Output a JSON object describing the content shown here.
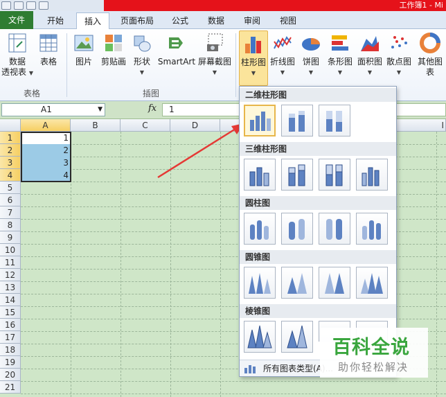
{
  "window": {
    "title": "工作簿1 - Mi"
  },
  "tabs": {
    "file": "文件",
    "home": "开始",
    "insert": "插入",
    "layout": "页面布局",
    "formulas": "公式",
    "data": "数据",
    "review": "审阅",
    "view": "视图"
  },
  "ribbon": {
    "pivot_line1": "数据",
    "pivot_line2": "透视表",
    "table": "表格",
    "picture": "图片",
    "clipart": "剪贴画",
    "shapes": "形状",
    "smartart": "SmartArt",
    "screenshot": "屏幕截图",
    "column": "柱形图",
    "line": "折线图",
    "pie": "饼图",
    "bar": "条形图",
    "area": "面积图",
    "scatter": "散点图",
    "other": "其他图表",
    "group_tables": "表格",
    "group_illustrations": "插图"
  },
  "formula_bar": {
    "name_box": "A1",
    "fx": "fx",
    "value": "1"
  },
  "sheet": {
    "columns": [
      "A",
      "B",
      "C",
      "D",
      "I"
    ],
    "rows": [
      "1",
      "2",
      "3",
      "4",
      "5",
      "6",
      "7",
      "8",
      "9",
      "10",
      "11",
      "12",
      "13",
      "14",
      "15",
      "16",
      "17",
      "18",
      "19",
      "20",
      "21"
    ],
    "a_values": [
      "1",
      "2",
      "3",
      "4"
    ]
  },
  "dropdown": {
    "sec_2d": "二维柱形图",
    "sec_3d": "三维柱形图",
    "sec_cyl": "圆柱图",
    "sec_cone": "圆锥图",
    "sec_pyr": "棱锥图",
    "footer": "所有图表类型(A)..."
  },
  "watermark": {
    "title": "百科全说",
    "subtitle": "助你轻松解决"
  },
  "colors": {
    "file_tab": "#2f7d32",
    "title_red": "#e5121a",
    "grid_green": "#cfe6c8",
    "selection_fill": "#9ccbe6",
    "arrow_red": "#e53935"
  }
}
